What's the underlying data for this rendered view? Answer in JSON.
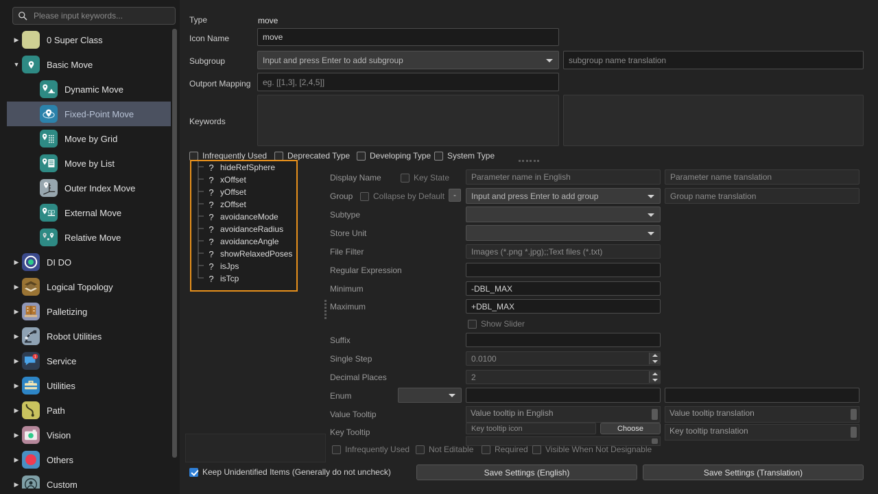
{
  "search": {
    "placeholder": "Please input keywords...",
    "value": "",
    "icon": "search-icon"
  },
  "sidebar": {
    "items": [
      {
        "label": "0 Super Class",
        "expanded": false,
        "level": 0,
        "icon": "super-class-icon",
        "color": "#ced093",
        "selected": false
      },
      {
        "label": "Basic Move",
        "expanded": true,
        "level": 0,
        "icon": "pin-icon",
        "color": "#2e8a84",
        "selected": false
      },
      {
        "label": "Dynamic Move",
        "level": 1,
        "icon": "pin-image-icon",
        "color": "#2e8a84",
        "selected": false
      },
      {
        "label": "Fixed-Point Move",
        "level": 1,
        "icon": "pin-fixed-icon",
        "color": "#2b82ab",
        "selected": true
      },
      {
        "label": "Move by Grid",
        "level": 1,
        "icon": "pin-grid-icon",
        "color": "#2e8a84",
        "selected": false
      },
      {
        "label": "Move by List",
        "level": 1,
        "icon": "pin-list-icon",
        "color": "#2e8a84",
        "selected": false
      },
      {
        "label": "Outer Index Move",
        "level": 1,
        "icon": "pin-axes-icon",
        "color": "#97a6ae",
        "selected": false
      },
      {
        "label": "External Move",
        "level": 1,
        "icon": "pin-external-icon",
        "color": "#2e8a84",
        "selected": false
      },
      {
        "label": "Relative Move",
        "level": 1,
        "icon": "pin-relative-icon",
        "color": "#2e8a84",
        "selected": false
      },
      {
        "label": "DI DO",
        "expanded": false,
        "level": 0,
        "icon": "circle-io-icon",
        "color": "#3b4a8c",
        "selected": false
      },
      {
        "label": "Logical Topology",
        "expanded": false,
        "level": 0,
        "icon": "layers-icon",
        "color": "#9a7434",
        "selected": false
      },
      {
        "label": "Palletizing",
        "expanded": false,
        "level": 0,
        "icon": "pallet-icon",
        "color": "#8f97b8",
        "selected": false
      },
      {
        "label": "Robot Utilities",
        "expanded": false,
        "level": 0,
        "icon": "robot-arm-icon",
        "color": "#8fa2b3",
        "selected": false
      },
      {
        "label": "Service",
        "expanded": false,
        "level": 0,
        "icon": "chat-badge-icon",
        "color": "#2e3d52",
        "selected": false
      },
      {
        "label": "Utilities",
        "expanded": false,
        "level": 0,
        "icon": "toolbox-icon",
        "color": "#2d85c6",
        "selected": false
      },
      {
        "label": "Path",
        "expanded": false,
        "level": 0,
        "icon": "path-curve-icon",
        "color": "#c9c35e",
        "selected": false
      },
      {
        "label": "Vision",
        "expanded": false,
        "level": 0,
        "icon": "camera-icon",
        "color": "#b5879a",
        "selected": false
      },
      {
        "label": "Others",
        "expanded": false,
        "level": 0,
        "icon": "red-dot-icon",
        "color": "#4a8fc4",
        "selected": false
      },
      {
        "label": "Custom",
        "expanded": false,
        "level": 0,
        "icon": "user-icon",
        "color": "#7f9fa6",
        "selected": false
      }
    ]
  },
  "header_form": {
    "type_label": "Type",
    "type_value": "move",
    "icon_name_label": "Icon Name",
    "icon_name_value": "move",
    "subgroup_label": "Subgroup",
    "subgroup_placeholder": "Input and press Enter to add subgroup",
    "subgroup_translation_placeholder": "subgroup name translation",
    "outport_label": "Outport Mapping",
    "outport_placeholder": "eg. [[1,3], [2,4,5]]",
    "keywords_label": "Keywords",
    "keywords_value": ""
  },
  "type_flags": [
    {
      "label": "Infrequently Used",
      "checked": false
    },
    {
      "label": "Deprecated Type",
      "checked": false
    },
    {
      "label": "Developing Type",
      "checked": false
    },
    {
      "label": "System Type",
      "checked": false
    }
  ],
  "param_list": {
    "items": [
      "hideRefSphere",
      "xOffset",
      "yOffset",
      "zOffset",
      "avoidanceMode",
      "avoidanceRadius",
      "avoidanceAngle",
      "showRelaxedPoses",
      "isJps",
      "isTcp"
    ],
    "item_icon": "question-mark-icon",
    "border_color": "#e8911c"
  },
  "detail_form": {
    "display_name_label": "Display Name",
    "key_state_label": "Key State",
    "key_state_checked": false,
    "display_name_placeholder": "Parameter name in English",
    "display_name_translation_placeholder": "Parameter name translation",
    "group_label": "Group",
    "collapse_label": "Collapse by Default",
    "collapse_checked": false,
    "minus_button_label": "-",
    "group_placeholder": "Input and press Enter to add group",
    "group_translation_placeholder": "Group name translation",
    "subtype_label": "Subtype",
    "subtype_value": "",
    "store_unit_label": "Store Unit",
    "store_unit_value": "",
    "file_filter_label": "File Filter",
    "file_filter_placeholder": "Images (*.png *.jpg);;Text files (*.txt)",
    "regular_expression_label": "Regular Expression",
    "regular_expression_value": "",
    "minimum_label": "Minimum",
    "minimum_value": "-DBL_MAX",
    "maximum_label": "Maximum",
    "maximum_value": "+DBL_MAX",
    "show_slider_label": "Show Slider",
    "show_slider_checked": false,
    "suffix_label": "Suffix",
    "suffix_value": "",
    "single_step_label": "Single Step",
    "single_step_value": "0.0100",
    "decimal_places_label": "Decimal Places",
    "decimal_places_value": "2",
    "enum_label": "Enum",
    "enum_select_value": "",
    "enum_value": "",
    "enum_translation_value": "",
    "value_tooltip_label": "Value Tooltip",
    "value_tooltip_placeholder": "Value tooltip in English",
    "value_tooltip_translation_placeholder": "Value tooltip translation",
    "key_tooltip_label": "Key Tooltip",
    "key_tooltip_icon_placeholder": "Key tooltip icon",
    "key_tooltip_translation_placeholder": "Key tooltip translation",
    "choose_button_label": "Choose"
  },
  "param_flags": [
    {
      "label": "Infrequently Used",
      "checked": false
    },
    {
      "label": "Not Editable",
      "checked": false
    },
    {
      "label": "Required",
      "checked": false
    },
    {
      "label": "Visible When Not Designable",
      "checked": false
    }
  ],
  "footer": {
    "keep_unidentified_label": "Keep Unidentified Items (Generally do not uncheck)",
    "keep_unidentified_checked": true,
    "save_english_label": "Save Settings (English)",
    "save_translation_label": "Save Settings (Translation)"
  },
  "colors": {
    "accent_orange": "#e8911c",
    "checkbox_blue": "#2f7fd6",
    "selection": "#4b5160",
    "panel_bg": "#232323",
    "sidebar_bg": "#1c1c1c"
  }
}
